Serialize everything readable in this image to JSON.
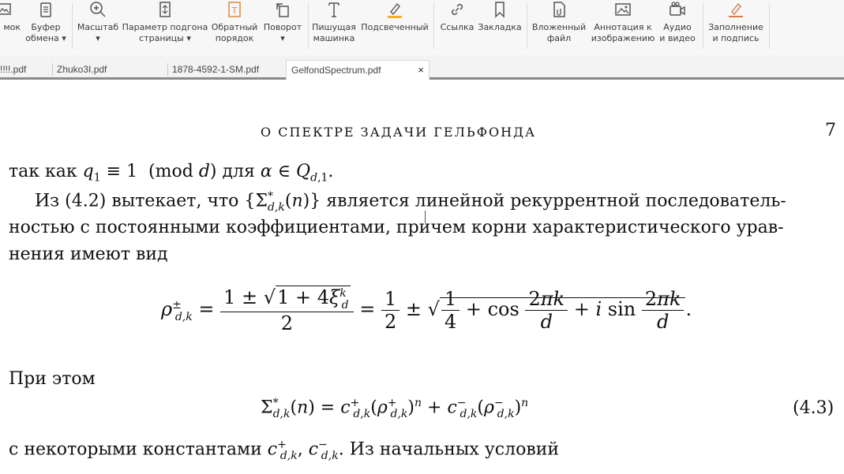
{
  "toolbar": {
    "buttons": [
      {
        "label": "мок",
        "icon": "image-icon"
      },
      {
        "label": "Буфер\nобмена ▾",
        "icon": "clipboard-icon"
      },
      {
        "label": "Масштаб\n▾",
        "icon": "zoom-in-icon"
      },
      {
        "label": "Параметр подгона\nстраницы ▾",
        "icon": "fit-page-icon"
      },
      {
        "label": "Обратный\nпорядок",
        "icon": "reverse-order-icon"
      },
      {
        "label": "Поворот\n▾",
        "icon": "rotate-icon"
      },
      {
        "label": "Пишущая\nмашинка",
        "icon": "typewriter-icon"
      },
      {
        "label": "Подсвеченный",
        "icon": "highlighter-icon"
      },
      {
        "label": "Ссылка",
        "icon": "link-icon"
      },
      {
        "label": "Закладка",
        "icon": "bookmark-icon"
      },
      {
        "label": "Вложенный\nфайл",
        "icon": "attachment-icon"
      },
      {
        "label": "Аннотация к\nизображению",
        "icon": "image-annotation-icon"
      },
      {
        "label": "Аудио\nи видео",
        "icon": "video-icon"
      },
      {
        "label": "Заполнение\nи подпись",
        "icon": "fill-sign-icon"
      }
    ]
  },
  "tabs": [
    {
      "label": "!!!!.pdf"
    },
    {
      "label": "Zhuko3I.pdf"
    },
    {
      "label": "1878-4592-1-SM.pdf"
    },
    {
      "label": "GelfondSpectrum.pdf",
      "active": true,
      "close": "×"
    }
  ],
  "document": {
    "running_header": "О СПЕКТРЕ ЗАДАЧИ ГЕЛЬФОНДА",
    "page_number": "7",
    "line1": "так как q₁ ≡ 1 (mod d) для α ∈ Q_{d,1}.",
    "para2_line1": "Из (4.2) вытекает, что {Σ*_{d,k}(n)} является линейной рекуррентной последователь-",
    "para2_line2": "ностью с постоянными коэффициентами, причем корни характеристического урав-",
    "para2_line3": "нения имеют вид",
    "formula1": "ρ±_{d,k} = (1 ± √(1 + 4ξᵏ_d))/2 = 1/2 ± √(1/4 + cos 2πk/d + i sin 2πk/d).",
    "text_pri_etom": "При этом",
    "formula2": "Σ*_{d,k}(n) = c⁺_{d,k}(ρ⁺_{d,k})ⁿ + c⁻_{d,k}(ρ⁻_{d,k})ⁿ",
    "equation_number": "(4.3)",
    "last_line": "с некоторыми константами c⁺_{d,k}, c⁻_{d,k}. Из начальных условий"
  }
}
